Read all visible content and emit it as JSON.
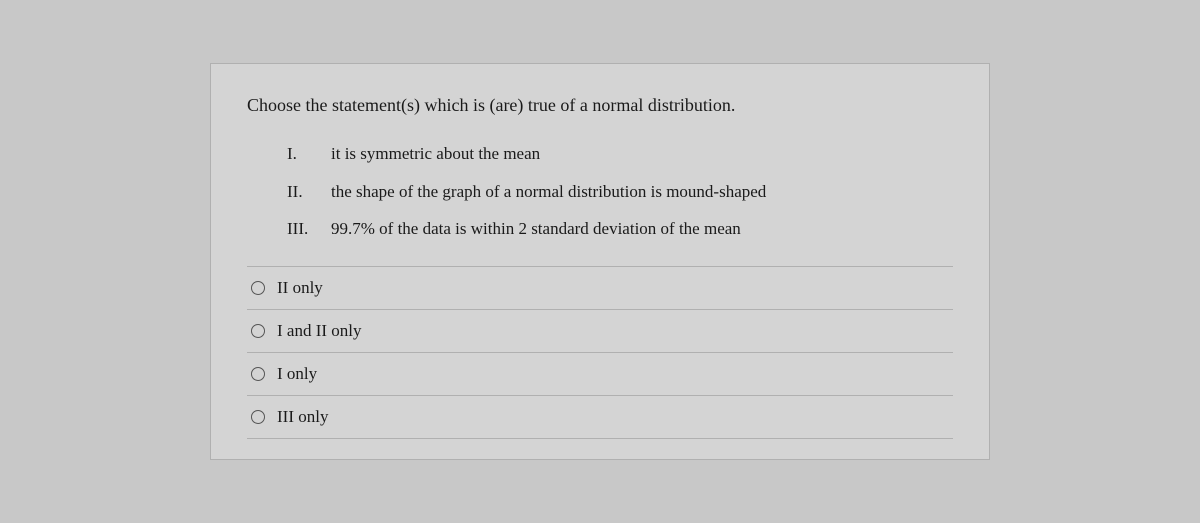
{
  "question": {
    "text": "Choose the statement(s) which is (are) true of a normal distribution.",
    "statements": [
      {
        "numeral": "I.",
        "text": "it is symmetric about the mean"
      },
      {
        "numeral": "II.",
        "text": "the shape of the graph of a normal distribution is mound-shaped"
      },
      {
        "numeral": "III.",
        "text": "99.7% of the data is within 2 standard deviation of the mean"
      }
    ],
    "options": [
      {
        "id": "opt-ii-only",
        "label": "II only"
      },
      {
        "id": "opt-i-and-ii-only",
        "label": "I and II only"
      },
      {
        "id": "opt-i-only",
        "label": "I only"
      },
      {
        "id": "opt-iii-only",
        "label": "III only"
      }
    ]
  }
}
